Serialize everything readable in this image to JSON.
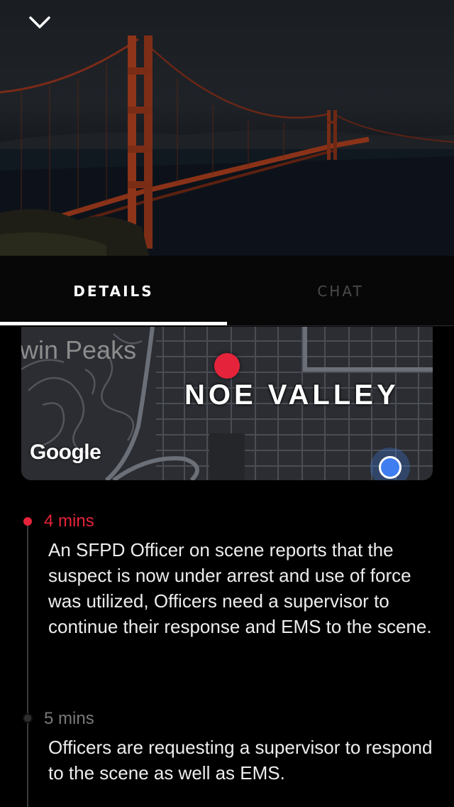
{
  "header": {
    "collapse_icon": "chevron-down-icon"
  },
  "tabs": [
    {
      "label": "DETAILS",
      "active": true
    },
    {
      "label": "CHAT",
      "active": false
    }
  ],
  "map": {
    "labels": {
      "twin_peaks": "win Peaks",
      "neighborhood": "NOE VALLEY",
      "attribution": "Google"
    },
    "pin_color": "#e5233a",
    "location_color": "#3f7df0"
  },
  "timeline": [
    {
      "time": "4 mins",
      "text": "An SFPD Officer on scene reports that the suspect is now under arrest and use of force was utilized, Officers need a supervisor to continue their response and EMS to the scene.",
      "color": "#e5233a"
    },
    {
      "time": "5 mins",
      "text": "Officers are requesting a supervisor to respond to the scene as well as EMS.",
      "color": "#7a7a7a"
    }
  ]
}
